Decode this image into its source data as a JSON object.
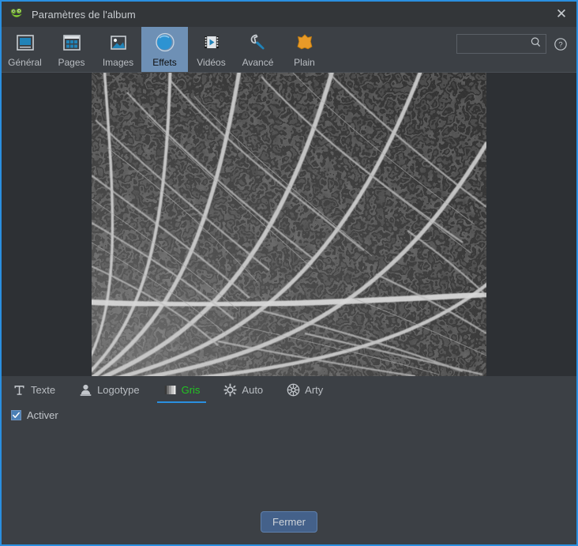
{
  "window": {
    "title": "Paramètres de l'album",
    "app_icon": "frog-icon",
    "close_label": "✕",
    "accent_color": "#2a8fe0",
    "background_color": "#3c4045",
    "titlebar_color": "#333639"
  },
  "toolbar": {
    "items": [
      {
        "label": "Général",
        "icon": "general-icon",
        "selected": false
      },
      {
        "label": "Pages",
        "icon": "pages-icon",
        "selected": false
      },
      {
        "label": "Images",
        "icon": "images-icon",
        "selected": false
      },
      {
        "label": "Effets",
        "icon": "effects-icon",
        "selected": true
      },
      {
        "label": "Vidéos",
        "icon": "videos-icon",
        "selected": false
      },
      {
        "label": "Avancé",
        "icon": "advanced-icon",
        "selected": false
      },
      {
        "label": "Plain",
        "icon": "skin-icon",
        "selected": false
      }
    ],
    "search": {
      "value": "",
      "placeholder": "",
      "icon": "search-icon"
    },
    "help": {
      "icon": "help-icon",
      "label": "?"
    }
  },
  "preview": {
    "image_alt": "leaf-vein-macro-grayscale",
    "background_color": "#2d3034"
  },
  "effect_tabs": [
    {
      "label": "Texte",
      "icon": "text-icon",
      "active": false
    },
    {
      "label": "Logotype",
      "icon": "logo-stamp-icon",
      "active": false
    },
    {
      "label": "Gris",
      "icon": "grayscale-bars-icon",
      "active": true
    },
    {
      "label": "Auto",
      "icon": "auto-sun-icon",
      "active": false
    },
    {
      "label": "Arty",
      "icon": "arty-flower-icon",
      "active": false
    }
  ],
  "options": {
    "enable_checkbox": {
      "label": "Activer",
      "checked": true
    }
  },
  "footer": {
    "close_button": "Fermer"
  }
}
